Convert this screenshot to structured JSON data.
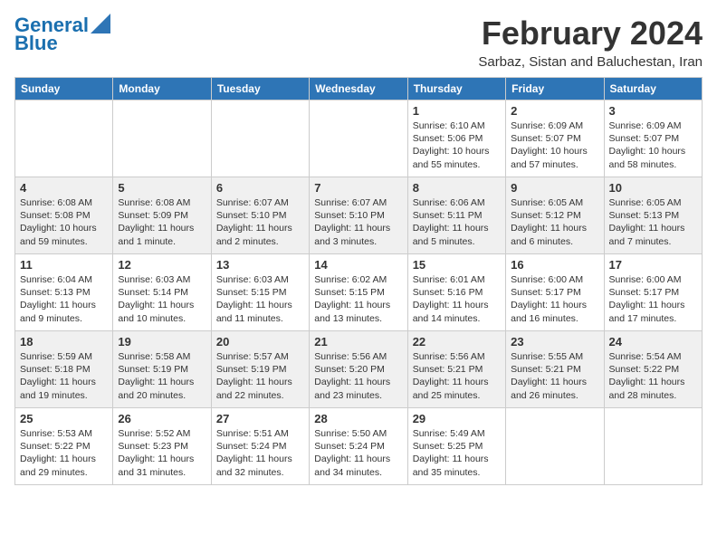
{
  "header": {
    "logo_line1": "General",
    "logo_line2": "Blue",
    "month": "February 2024",
    "location": "Sarbaz, Sistan and Baluchestan, Iran"
  },
  "weekdays": [
    "Sunday",
    "Monday",
    "Tuesday",
    "Wednesday",
    "Thursday",
    "Friday",
    "Saturday"
  ],
  "weeks": [
    [
      {
        "day": "",
        "info": ""
      },
      {
        "day": "",
        "info": ""
      },
      {
        "day": "",
        "info": ""
      },
      {
        "day": "",
        "info": ""
      },
      {
        "day": "1",
        "info": "Sunrise: 6:10 AM\nSunset: 5:06 PM\nDaylight: 10 hours and 55 minutes."
      },
      {
        "day": "2",
        "info": "Sunrise: 6:09 AM\nSunset: 5:07 PM\nDaylight: 10 hours and 57 minutes."
      },
      {
        "day": "3",
        "info": "Sunrise: 6:09 AM\nSunset: 5:07 PM\nDaylight: 10 hours and 58 minutes."
      }
    ],
    [
      {
        "day": "4",
        "info": "Sunrise: 6:08 AM\nSunset: 5:08 PM\nDaylight: 10 hours and 59 minutes."
      },
      {
        "day": "5",
        "info": "Sunrise: 6:08 AM\nSunset: 5:09 PM\nDaylight: 11 hours and 1 minute."
      },
      {
        "day": "6",
        "info": "Sunrise: 6:07 AM\nSunset: 5:10 PM\nDaylight: 11 hours and 2 minutes."
      },
      {
        "day": "7",
        "info": "Sunrise: 6:07 AM\nSunset: 5:10 PM\nDaylight: 11 hours and 3 minutes."
      },
      {
        "day": "8",
        "info": "Sunrise: 6:06 AM\nSunset: 5:11 PM\nDaylight: 11 hours and 5 minutes."
      },
      {
        "day": "9",
        "info": "Sunrise: 6:05 AM\nSunset: 5:12 PM\nDaylight: 11 hours and 6 minutes."
      },
      {
        "day": "10",
        "info": "Sunrise: 6:05 AM\nSunset: 5:13 PM\nDaylight: 11 hours and 7 minutes."
      }
    ],
    [
      {
        "day": "11",
        "info": "Sunrise: 6:04 AM\nSunset: 5:13 PM\nDaylight: 11 hours and 9 minutes."
      },
      {
        "day": "12",
        "info": "Sunrise: 6:03 AM\nSunset: 5:14 PM\nDaylight: 11 hours and 10 minutes."
      },
      {
        "day": "13",
        "info": "Sunrise: 6:03 AM\nSunset: 5:15 PM\nDaylight: 11 hours and 11 minutes."
      },
      {
        "day": "14",
        "info": "Sunrise: 6:02 AM\nSunset: 5:15 PM\nDaylight: 11 hours and 13 minutes."
      },
      {
        "day": "15",
        "info": "Sunrise: 6:01 AM\nSunset: 5:16 PM\nDaylight: 11 hours and 14 minutes."
      },
      {
        "day": "16",
        "info": "Sunrise: 6:00 AM\nSunset: 5:17 PM\nDaylight: 11 hours and 16 minutes."
      },
      {
        "day": "17",
        "info": "Sunrise: 6:00 AM\nSunset: 5:17 PM\nDaylight: 11 hours and 17 minutes."
      }
    ],
    [
      {
        "day": "18",
        "info": "Sunrise: 5:59 AM\nSunset: 5:18 PM\nDaylight: 11 hours and 19 minutes."
      },
      {
        "day": "19",
        "info": "Sunrise: 5:58 AM\nSunset: 5:19 PM\nDaylight: 11 hours and 20 minutes."
      },
      {
        "day": "20",
        "info": "Sunrise: 5:57 AM\nSunset: 5:19 PM\nDaylight: 11 hours and 22 minutes."
      },
      {
        "day": "21",
        "info": "Sunrise: 5:56 AM\nSunset: 5:20 PM\nDaylight: 11 hours and 23 minutes."
      },
      {
        "day": "22",
        "info": "Sunrise: 5:56 AM\nSunset: 5:21 PM\nDaylight: 11 hours and 25 minutes."
      },
      {
        "day": "23",
        "info": "Sunrise: 5:55 AM\nSunset: 5:21 PM\nDaylight: 11 hours and 26 minutes."
      },
      {
        "day": "24",
        "info": "Sunrise: 5:54 AM\nSunset: 5:22 PM\nDaylight: 11 hours and 28 minutes."
      }
    ],
    [
      {
        "day": "25",
        "info": "Sunrise: 5:53 AM\nSunset: 5:22 PM\nDaylight: 11 hours and 29 minutes."
      },
      {
        "day": "26",
        "info": "Sunrise: 5:52 AM\nSunset: 5:23 PM\nDaylight: 11 hours and 31 minutes."
      },
      {
        "day": "27",
        "info": "Sunrise: 5:51 AM\nSunset: 5:24 PM\nDaylight: 11 hours and 32 minutes."
      },
      {
        "day": "28",
        "info": "Sunrise: 5:50 AM\nSunset: 5:24 PM\nDaylight: 11 hours and 34 minutes."
      },
      {
        "day": "29",
        "info": "Sunrise: 5:49 AM\nSunset: 5:25 PM\nDaylight: 11 hours and 35 minutes."
      },
      {
        "day": "",
        "info": ""
      },
      {
        "day": "",
        "info": ""
      }
    ]
  ]
}
